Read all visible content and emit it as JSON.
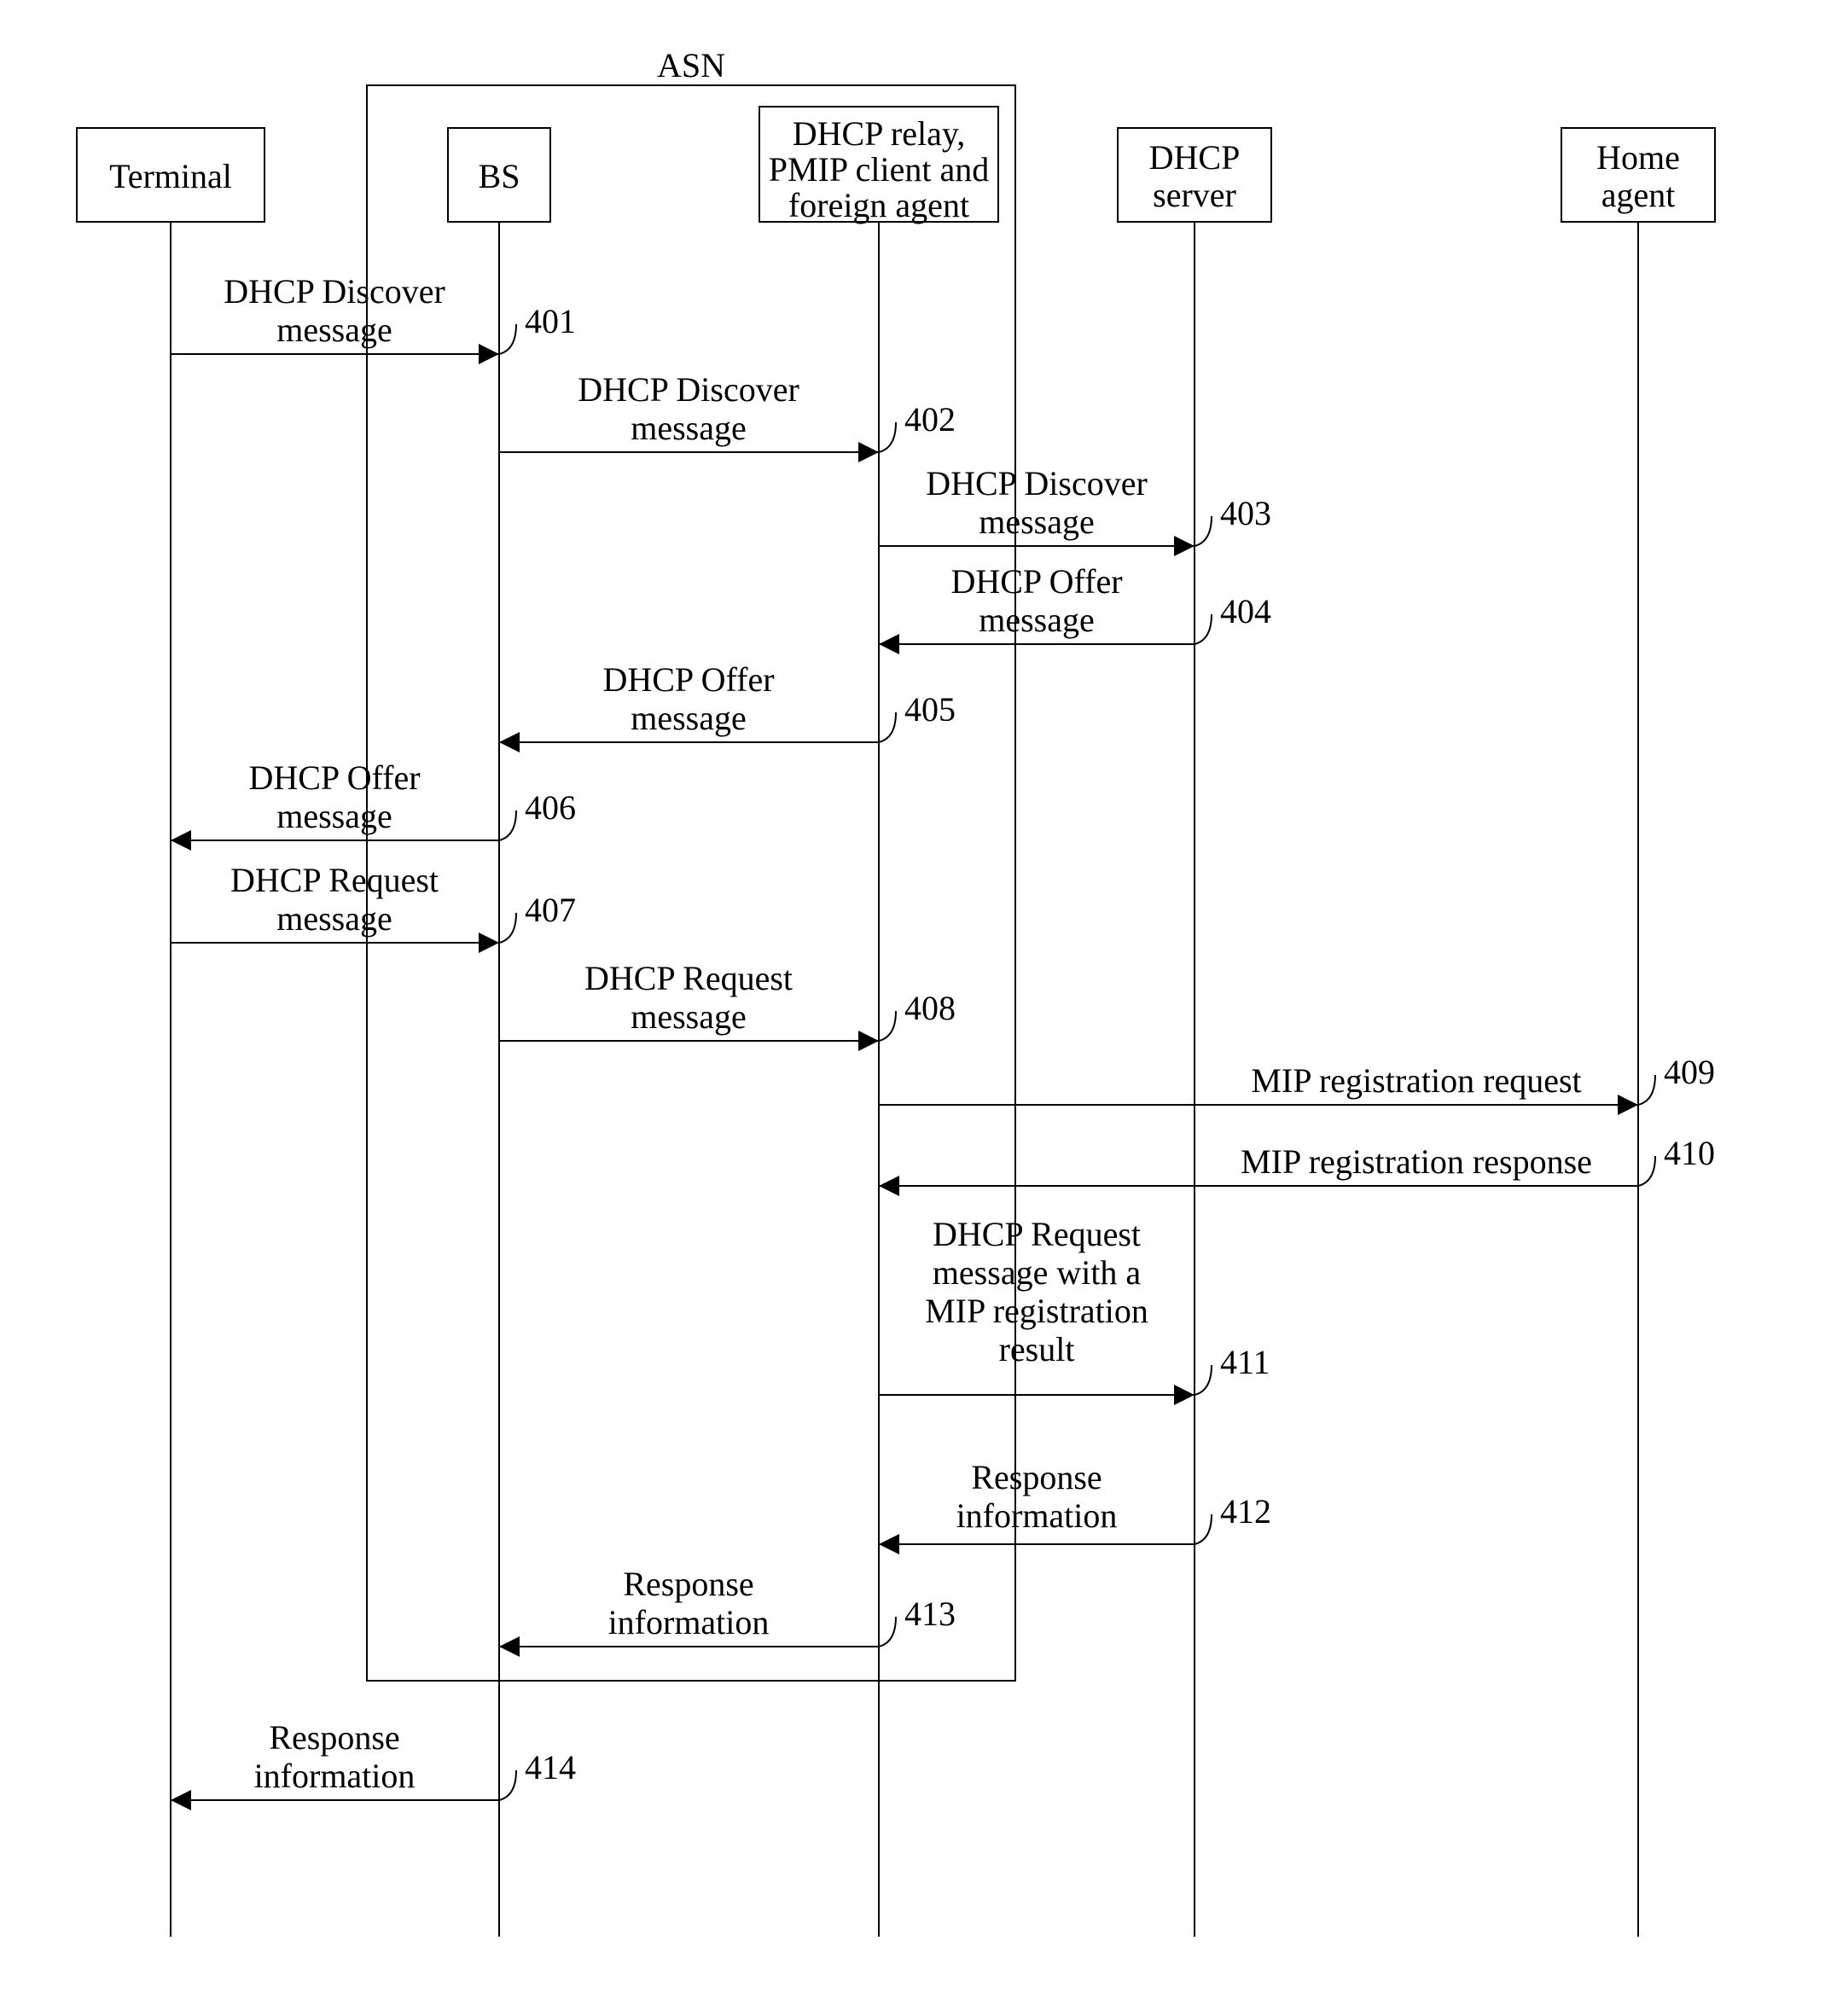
{
  "asn_label": "ASN",
  "participants": {
    "p1": "Terminal",
    "p2": "BS",
    "p3_l1": "DHCP relay,",
    "p3_l2": "PMIP client and",
    "p3_l3": "foreign agent",
    "p4_l1": "DHCP",
    "p4_l2": "server",
    "p5_l1": "Home",
    "p5_l2": "agent"
  },
  "messages": {
    "m401_l1": "DHCP Discover",
    "m401_l2": "message",
    "n401": "401",
    "m402_l1": "DHCP Discover",
    "m402_l2": "message",
    "n402": "402",
    "m403_l1": "DHCP Discover",
    "m403_l2": "message",
    "n403": "403",
    "m404_l1": "DHCP Offer",
    "m404_l2": "message",
    "n404": "404",
    "m405_l1": "DHCP Offer",
    "m405_l2": "message",
    "n405": "405",
    "m406_l1": "DHCP Offer",
    "m406_l2": "message",
    "n406": "406",
    "m407_l1": "DHCP Request",
    "m407_l2": "message",
    "n407": "407",
    "m408_l1": "DHCP Request",
    "m408_l2": "message",
    "n408": "408",
    "m409": "MIP registration request",
    "n409": "409",
    "m410": "MIP registration response",
    "n410": "410",
    "m411_l1": "DHCP Request",
    "m411_l2": "message with a",
    "m411_l3": "MIP registration",
    "m411_l4": "result",
    "n411": "411",
    "m412_l1": "Response",
    "m412_l2": "information",
    "n412": "412",
    "m413_l1": "Response",
    "m413_l2": "information",
    "n413": "413",
    "m414_l1": "Response",
    "m414_l2": "information",
    "n414": "414"
  }
}
